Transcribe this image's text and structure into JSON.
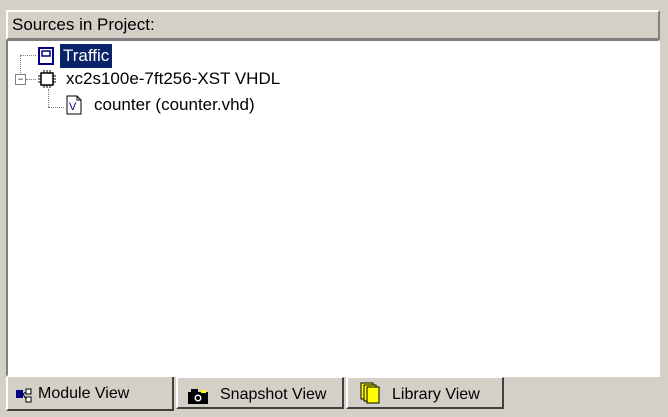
{
  "panel": {
    "title": "Sources in Project:"
  },
  "tree": {
    "items": [
      {
        "label": "Traffic",
        "selected": true,
        "icon": "project-icon"
      },
      {
        "label": "xc2s100e-7ft256-XST VHDL",
        "selected": false,
        "icon": "chip-icon",
        "expanded": true
      },
      {
        "label": "counter (counter.vhd)",
        "selected": false,
        "icon": "vhdl-file-icon"
      }
    ]
  },
  "tabs": [
    {
      "label": "Module View",
      "icon": "module-view-icon",
      "active": true
    },
    {
      "label": "Snapshot View",
      "icon": "camera-icon",
      "active": false
    },
    {
      "label": "Library View",
      "icon": "library-icon",
      "active": false
    }
  ],
  "colors": {
    "selection": "#0a246a",
    "face": "#d4d0c8",
    "window": "#ffffff"
  }
}
